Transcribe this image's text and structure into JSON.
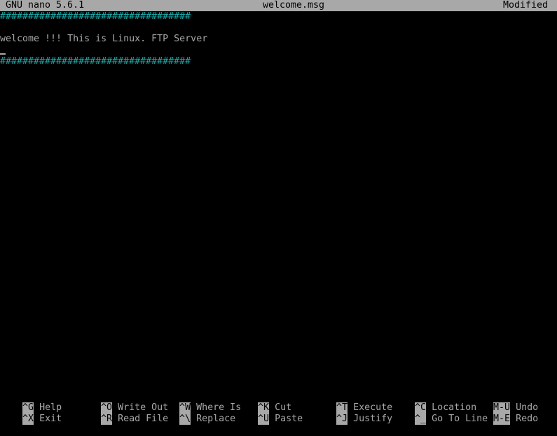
{
  "titlebar": {
    "app": "GNU nano 5.6.1",
    "filename": "welcome.msg",
    "status": "Modified"
  },
  "buffer": {
    "hash_line_1": "##################################",
    "blank_line": "",
    "text_line": "welcome !!! This is Linux. FTP Server",
    "hash_line_2": "##################################"
  },
  "shortcuts": {
    "row1": [
      {
        "key": "^G",
        "label": "Help"
      },
      {
        "key": "^O",
        "label": "Write Out"
      },
      {
        "key": "^W",
        "label": "Where Is"
      },
      {
        "key": "^K",
        "label": "Cut"
      },
      {
        "key": "^T",
        "label": "Execute"
      },
      {
        "key": "^C",
        "label": "Location"
      },
      {
        "key": "M-U",
        "label": "Undo"
      }
    ],
    "row2": [
      {
        "key": "^X",
        "label": "Exit"
      },
      {
        "key": "^R",
        "label": "Read File"
      },
      {
        "key": "^\\",
        "label": "Replace"
      },
      {
        "key": "^U",
        "label": "Paste"
      },
      {
        "key": "^J",
        "label": "Justify"
      },
      {
        "key": "^_",
        "label": "Go To Line"
      },
      {
        "key": "M-E",
        "label": "Redo"
      }
    ]
  },
  "colors": {
    "background": "#000000",
    "foreground": "#a8a8a8",
    "accent_cyan": "#17a8a8"
  }
}
